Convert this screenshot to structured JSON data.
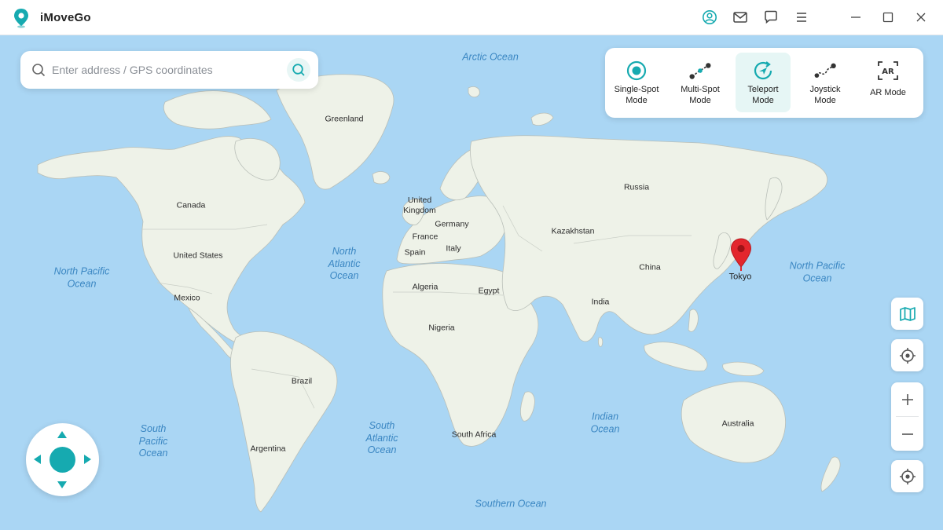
{
  "app": {
    "title": "iMoveGo",
    "accent_color": "#16aab0",
    "titlebar_icons": [
      "account-icon",
      "mail-icon",
      "feedback-icon",
      "menu-icon",
      "minimize-icon",
      "maximize-icon",
      "close-icon"
    ]
  },
  "search": {
    "placeholder": "Enter address / GPS coordinates",
    "value": ""
  },
  "modes": [
    {
      "label": "Single-Spot\nMode",
      "icon": "single-spot-icon",
      "active": false
    },
    {
      "label": "Multi-Spot\nMode",
      "icon": "multi-spot-icon",
      "active": false
    },
    {
      "label": "Teleport\nMode",
      "icon": "teleport-icon",
      "active": true
    },
    {
      "label": "Joystick\nMode",
      "icon": "joystick-icon",
      "active": false
    },
    {
      "label": "AR Mode",
      "icon": "ar-icon",
      "active": false
    }
  ],
  "map": {
    "land_color": "#eef2e8",
    "water_color": "#aad6f4",
    "pin": {
      "label": "Tokyo",
      "color": "#e3262d"
    },
    "countries": [
      "Greenland",
      "Canada",
      "United States",
      "Mexico",
      "Brazil",
      "Argentina",
      "United\nKingdom",
      "France",
      "Spain",
      "Germany",
      "Italy",
      "Algeria",
      "Egypt",
      "Nigeria",
      "South Africa",
      "Russia",
      "Kazakhstan",
      "China",
      "India",
      "Australia"
    ],
    "oceans": [
      "Arctic Ocean",
      "North Pacific\nOcean",
      "North\nAtlantic\nOcean",
      "North Pacific\nOcean",
      "South\nPacific\nOcean",
      "South\nAtlantic\nOcean",
      "Indian\nOcean",
      "Southern Ocean"
    ]
  },
  "controls": [
    "map-layers-icon",
    "locate-icon",
    "zoom-in-icon",
    "zoom-out-icon",
    "recenter-icon"
  ]
}
